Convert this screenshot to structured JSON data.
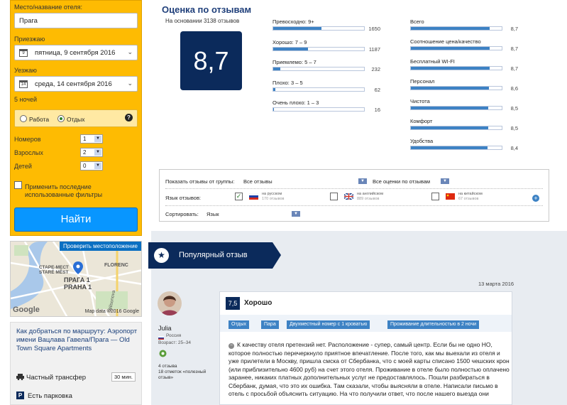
{
  "search": {
    "hotel_label": "Место/название отеля:",
    "hotel_value": "Прага",
    "checkin_label": "Приезжаю",
    "checkin_day": "9",
    "checkin_value": "пятница, 9 сентября 2016",
    "checkout_label": "Уезжаю",
    "checkout_day": "14",
    "checkout_value": "среда, 14 сентября 2016",
    "nights": "5 ночей",
    "trip_work": "Работа",
    "trip_leisure": "Отдых",
    "rooms_label": "Номеров",
    "rooms_value": "1",
    "adults_label": "Взрослых",
    "adults_value": "2",
    "children_label": "Детей",
    "children_value": "0",
    "apply_filters": "Применить последние использованные фильтры",
    "find_button": "Найти"
  },
  "map": {
    "show_button": "Проверить местоположение",
    "labels": [
      "СТАРЕ-МЕСТ",
      "STARÉ MĚST",
      "ПРАГА 1",
      "PRAHA 1",
      "FLORENC",
      "Wilsonova"
    ],
    "credit": "Map data ©2016 Google",
    "google": "Google"
  },
  "directions": {
    "route_text": "Как добраться по маршруту: Аэропорт имени Вацлава Гавела/Прага — Old Town Square Apartments",
    "transfer": "Частный трансфер",
    "transfer_time": "30 мин.",
    "parking": "Есть парковка"
  },
  "scores": {
    "title": "Оценка по отзывам",
    "subtitle": "На основании 3138 отзывов",
    "overall": "8,7",
    "distribution": [
      {
        "label": "Превосходно: 9+",
        "count": "1650",
        "fraction": 0.53
      },
      {
        "label": "Хорошо: 7 – 9",
        "count": "1187",
        "fraction": 0.38
      },
      {
        "label": "Приемлемо: 5 – 7",
        "count": "232",
        "fraction": 0.08
      },
      {
        "label": "Плохо: 3 – 5",
        "count": "62",
        "fraction": 0.02
      },
      {
        "label": "Очень плохо: 1 – 3",
        "count": "16",
        "fraction": 0.01
      }
    ],
    "categories": [
      {
        "label": "Всего",
        "value": "8,7",
        "fraction": 0.87
      },
      {
        "label": "Соотношение цена/качество",
        "value": "8,7",
        "fraction": 0.87
      },
      {
        "label": "Бесплатный WI-FI",
        "value": "8,7",
        "fraction": 0.87
      },
      {
        "label": "Персонал",
        "value": "8,6",
        "fraction": 0.86
      },
      {
        "label": "Чистота",
        "value": "8,5",
        "fraction": 0.85
      },
      {
        "label": "Комфорт",
        "value": "8,5",
        "fraction": 0.85
      },
      {
        "label": "Удобства",
        "value": "8,4",
        "fraction": 0.84
      }
    ]
  },
  "filters": {
    "group_label": "Показать отзывы от группы:",
    "group_value": "Все отзывы",
    "scores_value": "Все оценки по отзывам",
    "lang_label": "Язык отзывов:",
    "lang_ru": "на русском",
    "lang_ru_count": "170 отзывов",
    "lang_en": "на английском",
    "lang_en_count": "889 отзывов",
    "lang_zh": "на китайском",
    "lang_zh_count": "67 отзывов",
    "sort_label": "Сортировать:",
    "sort_value": "Язык"
  },
  "popular": {
    "banner": "Популярный отзыв",
    "date": "13 марта 2016",
    "reviewer_name": "Julia",
    "reviewer_country": "Россия",
    "reviewer_age": "Возраст: 25–34",
    "reviewer_stats": "4 отзыва\n18 отметок «полезный отзыв»",
    "score": "7,5",
    "heading": "Хорошо",
    "tags": [
      "Отдых",
      "Пара",
      "Двухместный номер с 1 кроватью",
      "Проживание длительностью в 2 ночи"
    ],
    "text": "К качеству отеля претензий нет. Расположение - супер, самый центр. Если бы не одно НО, которое полностью перечеркнуло приятное впечатление. После того, как мы выехали из отеля и уже прилетели в Москву, пришла смска от Сбербанка, что с моей карты списано 1500 чешских крон (или приблизительно 4600 руб) на счет этого отеля. Проживание в отеле было полностью оплачено заранее, никаких платных дополнительных услуг не предоставлялось. Пошли разбираться в Сбербанк, думая, что это их ошибка. Там сказали, чтобы выясняли в отеле. Написали письмо в отель с просьбой объяснить ситуацию. На что получили ответ, что после нашего выезда они"
  },
  "colors": {
    "search_bg": "#febb02",
    "navy": "#0b2a5b",
    "blue": "#0896ff",
    "bar": "#3d82c4"
  }
}
